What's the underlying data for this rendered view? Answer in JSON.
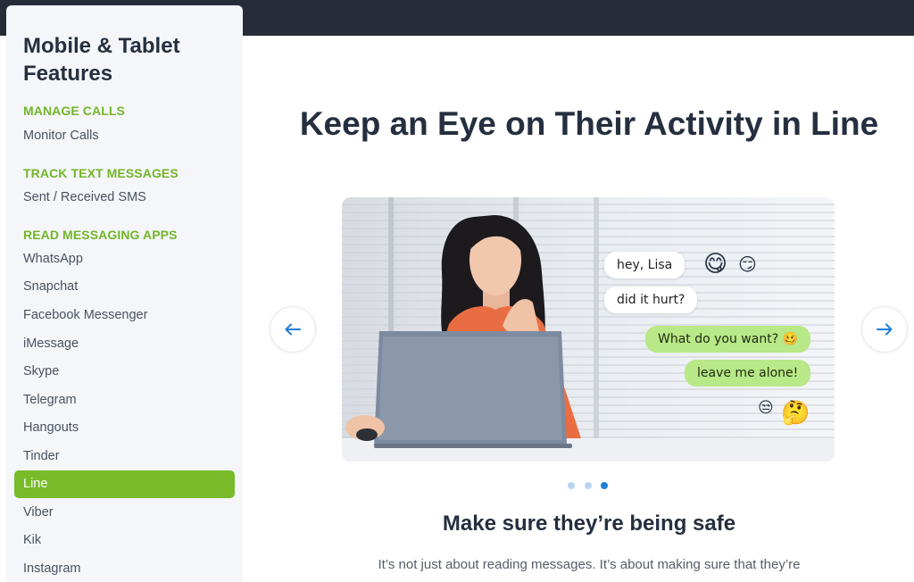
{
  "sidebar": {
    "title": "Mobile & Tablet Features",
    "sections": [
      {
        "heading": "MANAGE CALLS",
        "items": [
          "Monitor Calls"
        ]
      },
      {
        "heading": "TRACK TEXT MESSAGES",
        "items": [
          "Sent / Received SMS"
        ]
      },
      {
        "heading": "READ MESSAGING APPS",
        "items": [
          "WhatsApp",
          "Snapchat",
          "Facebook Messenger",
          "iMessage",
          "Skype",
          "Telegram",
          "Hangouts",
          "Tinder",
          "Line",
          "Viber",
          "Kik",
          "Instagram"
        ]
      }
    ],
    "active_item": "Line"
  },
  "main": {
    "title": "Keep an Eye on Their Activity in Line",
    "subtitle": "Make sure they’re being safe",
    "body": "It’s not just about reading messages. It’s about making sure that they’re"
  },
  "carousel": {
    "prev_icon": "arrow-left-icon",
    "next_icon": "arrow-right-icon",
    "slide_count": 3,
    "active_slide": 3,
    "chat": {
      "incoming": [
        "hey, Lisa",
        "did it hurt?"
      ],
      "outgoing": [
        "What do you want? 🥴",
        "leave me alone!"
      ],
      "emojis": [
        "😋",
        "😏",
        "😒",
        "🤔"
      ]
    }
  },
  "colors": {
    "topbar": "#262c38",
    "accent_green": "#78ba2a",
    "section_green": "#74b52a",
    "arrow_blue": "#1e7fd6",
    "heading": "#252f3f"
  }
}
